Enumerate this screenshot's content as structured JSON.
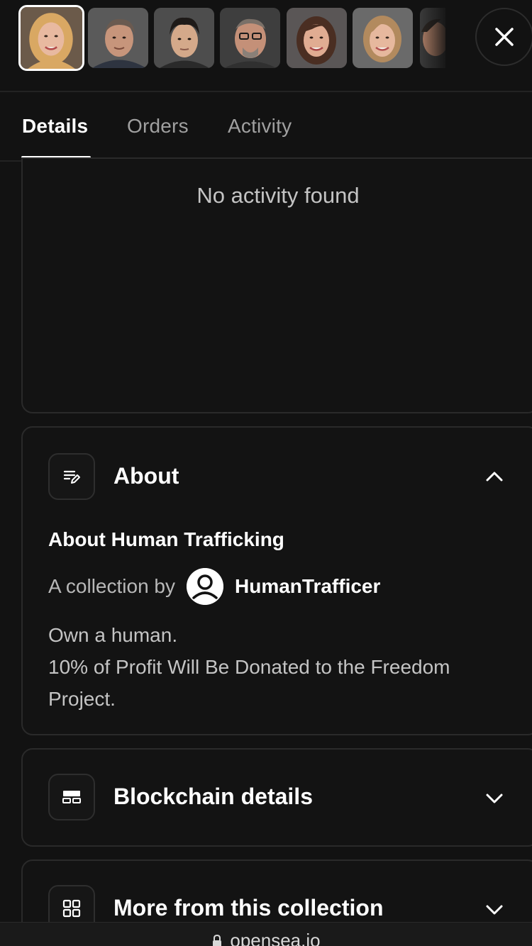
{
  "thumbnails": [
    {
      "name": "avatar-blonde-woman",
      "bg": "#6b5a4a",
      "skin": "#e8b9a0",
      "hair": "#d9a863",
      "selected": true
    },
    {
      "name": "avatar-man-gray-hair",
      "bg": "#5a5a5a",
      "skin": "#c7957b",
      "hair": "#6a5a50",
      "selected": false
    },
    {
      "name": "avatar-young-man",
      "bg": "#4d4d4d",
      "skin": "#d4a98a",
      "hair": "#1e1a18",
      "selected": false
    },
    {
      "name": "avatar-man-glasses",
      "bg": "#3e3e3e",
      "skin": "#c49078",
      "hair": "#7a7068",
      "selected": false
    },
    {
      "name": "avatar-brunette-woman",
      "bg": "#5a5656",
      "skin": "#e0ac92",
      "hair": "#4a2e22",
      "selected": false
    },
    {
      "name": "avatar-smiling-woman",
      "bg": "#6a6a6a",
      "skin": "#e6b89e",
      "hair": "#b28a5e",
      "selected": false
    },
    {
      "name": "avatar-partial",
      "bg": "#3a3a3a",
      "skin": "#b08068",
      "hair": "#2a2420",
      "selected": false
    }
  ],
  "tabs": [
    {
      "label": "Details",
      "active": true
    },
    {
      "label": "Orders",
      "active": false
    },
    {
      "label": "Activity",
      "active": false
    }
  ],
  "activity": {
    "empty_text": "No activity found"
  },
  "about": {
    "title": "About",
    "icon": "notes-edit-icon",
    "subtitle": "About Human Trafficking",
    "collection_by": "A collection by",
    "creator": "HumanTrafficer",
    "description_line1": "Own a human.",
    "description_line2": "10% of Profit Will Be Donated to the Freedom Project."
  },
  "blockchain": {
    "title": "Blockchain details",
    "icon": "layout-icon"
  },
  "more": {
    "title": "More from this collection",
    "icon": "grid-icon"
  },
  "browser": {
    "url": "opensea.io",
    "icon": "lock-icon"
  },
  "colors": {
    "background": "#121212",
    "card_border": "#2a2a2a",
    "text_primary": "#ffffff",
    "text_secondary": "#c4c4c4"
  }
}
